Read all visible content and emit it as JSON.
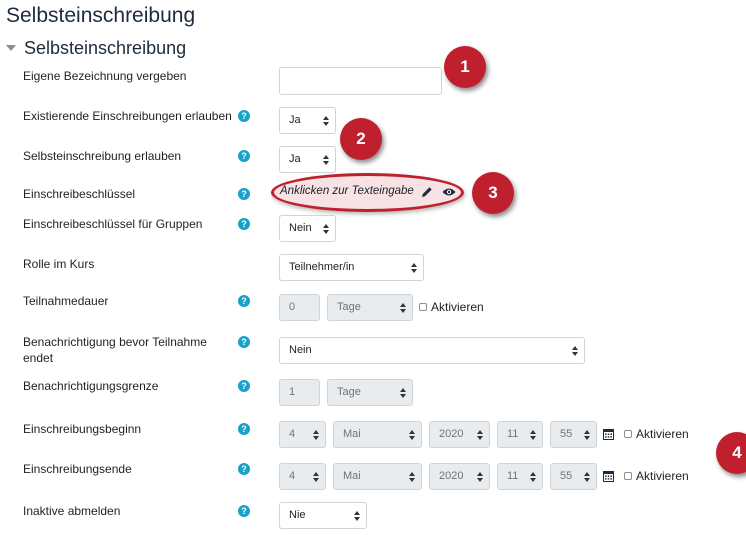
{
  "page_title": "Selbsteinschreibung",
  "section_title": "Selbsteinschreibung",
  "fields": {
    "custom_name": {
      "label": "Eigene Bezeichnung vergeben",
      "value": ""
    },
    "existing_enrol": {
      "label": "Existierende Einschreibungen erlauben",
      "value": "Ja"
    },
    "allow_self": {
      "label": "Selbsteinschreibung erlauben",
      "value": "Ja"
    },
    "enrol_key": {
      "label": "Einschreibeschlüssel",
      "value": "Anklicken zur Texteingabe"
    },
    "group_key": {
      "label": "Einschreibeschlüssel für Gruppen",
      "value": "Nein"
    },
    "role": {
      "label": "Rolle im Kurs",
      "value": "Teilnehmer/in"
    },
    "duration": {
      "label": "Teilnahmedauer",
      "number": "0",
      "unit": "Tage",
      "enable_label": "Aktivieren"
    },
    "notify_before": {
      "label_line1": "Benachrichtigung bevor Teilnahme",
      "label_line2": "endet",
      "value": "Nein"
    },
    "notify_threshold": {
      "label": "Benachrichtigungsgrenze",
      "number": "1",
      "unit": "Tage"
    },
    "enrol_start": {
      "label": "Einschreibungsbeginn",
      "day": "4",
      "month": "Mai",
      "year": "2020",
      "hour": "11",
      "minute": "55",
      "enable_label": "Aktivieren"
    },
    "enrol_end": {
      "label": "Einschreibungsende",
      "day": "4",
      "month": "Mai",
      "year": "2020",
      "hour": "11",
      "minute": "55",
      "enable_label": "Aktivieren"
    },
    "inactive": {
      "label": "Inaktive abmelden",
      "value": "Nie"
    }
  },
  "help_glyph": "?",
  "icons": {
    "help": "question-circle-icon",
    "edit": "pencil-icon",
    "reveal": "eye-icon",
    "calendar": "calendar-icon",
    "collapse": "caret-down-icon"
  },
  "callouts": [
    "1",
    "2",
    "3",
    "4"
  ],
  "colors": {
    "accent": "#c0202e",
    "help": "#1aa1c7",
    "heading": "#1d2b3a"
  }
}
